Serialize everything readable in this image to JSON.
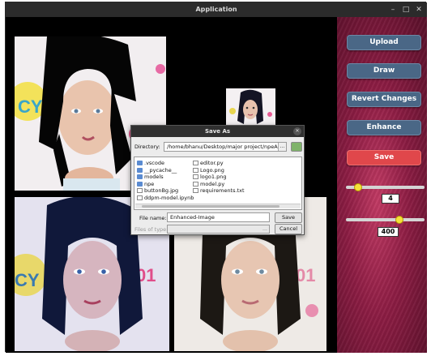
{
  "window": {
    "title": "Application",
    "controls": {
      "minimize": "–",
      "maximize": "□",
      "close": "✕"
    }
  },
  "sidebar": {
    "upload_label": "Upload",
    "draw_label": "Draw",
    "revert_label": "Revert Changes",
    "enhance_label": "Enhance",
    "save_label": "Save",
    "slider1": {
      "value": "4",
      "level": 0.12
    },
    "slider2": {
      "value": "400",
      "level": 0.7
    }
  },
  "dialog": {
    "title": "Save As",
    "directory_label": "Directory:",
    "directory_value": "/home/bhanu/Desktop/major project/npeApp",
    "files_col1": [
      {
        "name": ".vscode",
        "kind": "folder"
      },
      {
        "name": "__pycache__",
        "kind": "folder"
      },
      {
        "name": "models",
        "kind": "folder"
      },
      {
        "name": "npe",
        "kind": "folder"
      },
      {
        "name": "buttonBg.jpg",
        "kind": "file"
      },
      {
        "name": "ddpm-model.ipynb",
        "kind": "file"
      }
    ],
    "files_col2": [
      {
        "name": "editor.py",
        "kind": "file"
      },
      {
        "name": "Logo.png",
        "kind": "file"
      },
      {
        "name": "logo1.png",
        "kind": "file"
      },
      {
        "name": "model.py",
        "kind": "file"
      },
      {
        "name": "requirements.txt",
        "kind": "file"
      }
    ],
    "filename_label": "File name:",
    "filename_value": "Enhanced-Image",
    "save_label": "Save",
    "filetype_label": "Files of type:",
    "cancel_label": "Cancel"
  },
  "colors": {
    "button_blue": "#4a6786",
    "button_red": "#e0474b",
    "sidebar_bg": "#8c1c43",
    "slider_knob": "#f5e03a"
  }
}
